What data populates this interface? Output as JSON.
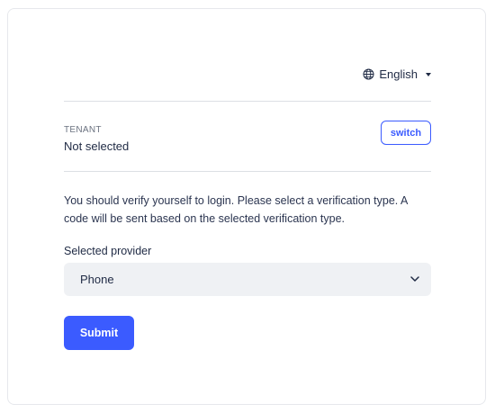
{
  "language": {
    "label": "English",
    "icon": "globe-icon"
  },
  "tenant": {
    "label": "TENANT",
    "value": "Not selected",
    "switch_label": "switch"
  },
  "info": {
    "text": "You should verify yourself to login. Please select a verification type. A code will be sent based on the selected verification type."
  },
  "provider": {
    "label": "Selected provider",
    "selected": "Phone"
  },
  "submit": {
    "label": "Submit"
  },
  "colors": {
    "accent": "#3b5bff",
    "text": "#1f2a44",
    "muted": "#6b7280",
    "select_bg": "#eff1f4",
    "divider": "#dcdfe4"
  }
}
